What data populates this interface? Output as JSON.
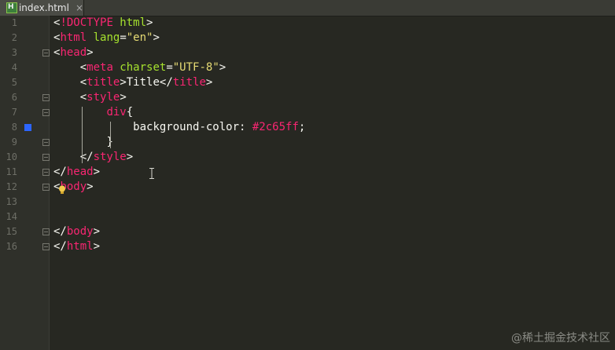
{
  "tab": {
    "filename": "index.html",
    "close_glyph": "×",
    "icon_letter": "H"
  },
  "editor": {
    "line_numbers": [
      "1",
      "2",
      "3",
      "4",
      "5",
      "6",
      "7",
      "8",
      "9",
      "10",
      "11",
      "12",
      "13",
      "14",
      "15",
      "16"
    ],
    "lines": [
      {
        "indent": "",
        "tokens": [
          {
            "c": "punc",
            "t": "<"
          },
          {
            "c": "tag",
            "t": "!DOCTYPE"
          },
          {
            "c": "attr",
            "t": " html"
          },
          {
            "c": "punc",
            "t": ">"
          }
        ]
      },
      {
        "indent": "",
        "tokens": [
          {
            "c": "punc",
            "t": "<"
          },
          {
            "c": "tag",
            "t": "html"
          },
          {
            "c": "attr",
            "t": " lang"
          },
          {
            "c": "punc",
            "t": "="
          },
          {
            "c": "str",
            "t": "\"en\""
          },
          {
            "c": "punc",
            "t": ">"
          }
        ]
      },
      {
        "indent": "",
        "tokens": [
          {
            "c": "punc",
            "t": "<"
          },
          {
            "c": "tag",
            "t": "head"
          },
          {
            "c": "punc",
            "t": ">"
          }
        ]
      },
      {
        "indent": "    ",
        "tokens": [
          {
            "c": "punc",
            "t": "<"
          },
          {
            "c": "tag",
            "t": "meta"
          },
          {
            "c": "attr",
            "t": " charset"
          },
          {
            "c": "punc",
            "t": "="
          },
          {
            "c": "str",
            "t": "\"UTF-8\""
          },
          {
            "c": "punc",
            "t": ">"
          }
        ]
      },
      {
        "indent": "    ",
        "tokens": [
          {
            "c": "punc",
            "t": "<"
          },
          {
            "c": "tag",
            "t": "title"
          },
          {
            "c": "punc",
            "t": ">"
          },
          {
            "c": "prop",
            "t": "Title"
          },
          {
            "c": "punc",
            "t": "</"
          },
          {
            "c": "tag",
            "t": "title"
          },
          {
            "c": "punc",
            "t": ">"
          }
        ]
      },
      {
        "indent": "    ",
        "tokens": [
          {
            "c": "punc",
            "t": "<"
          },
          {
            "c": "tag",
            "t": "style"
          },
          {
            "c": "punc",
            "t": ">"
          }
        ]
      },
      {
        "indent": "        ",
        "tokens": [
          {
            "c": "tag",
            "t": "div"
          },
          {
            "c": "punc",
            "t": "{"
          }
        ]
      },
      {
        "indent": "            ",
        "tokens": [
          {
            "c": "prop",
            "t": "background-color"
          },
          {
            "c": "punc",
            "t": ": "
          },
          {
            "c": "num",
            "t": "#2c65ff"
          },
          {
            "c": "punc",
            "t": ";"
          }
        ]
      },
      {
        "indent": "        ",
        "tokens": [
          {
            "c": "punc",
            "t": "}"
          }
        ]
      },
      {
        "indent": "    ",
        "tokens": [
          {
            "c": "punc",
            "t": "</"
          },
          {
            "c": "tag",
            "t": "style"
          },
          {
            "c": "punc",
            "t": ">"
          }
        ]
      },
      {
        "indent": "",
        "tokens": [
          {
            "c": "punc",
            "t": "</"
          },
          {
            "c": "tag",
            "t": "head"
          },
          {
            "c": "punc",
            "t": ">"
          }
        ]
      },
      {
        "indent": "",
        "tokens": [
          {
            "c": "punc",
            "t": "<"
          },
          {
            "c": "tag",
            "t": "body"
          },
          {
            "c": "punc",
            "t": ">"
          }
        ]
      },
      {
        "indent": "",
        "tokens": []
      },
      {
        "indent": "",
        "tokens": []
      },
      {
        "indent": "",
        "tokens": [
          {
            "c": "punc",
            "t": "</"
          },
          {
            "c": "tag",
            "t": "body"
          },
          {
            "c": "punc",
            "t": ">"
          }
        ]
      },
      {
        "indent": "",
        "tokens": [
          {
            "c": "punc",
            "t": "</"
          },
          {
            "c": "tag",
            "t": "html"
          },
          {
            "c": "punc",
            "t": ">"
          }
        ]
      }
    ],
    "color_marker": "#2c65ff",
    "intention_icon": "lightbulb-icon",
    "text_cursor_icon": "i-beam-cursor-icon"
  },
  "watermark": "@稀土掘金技术社区"
}
